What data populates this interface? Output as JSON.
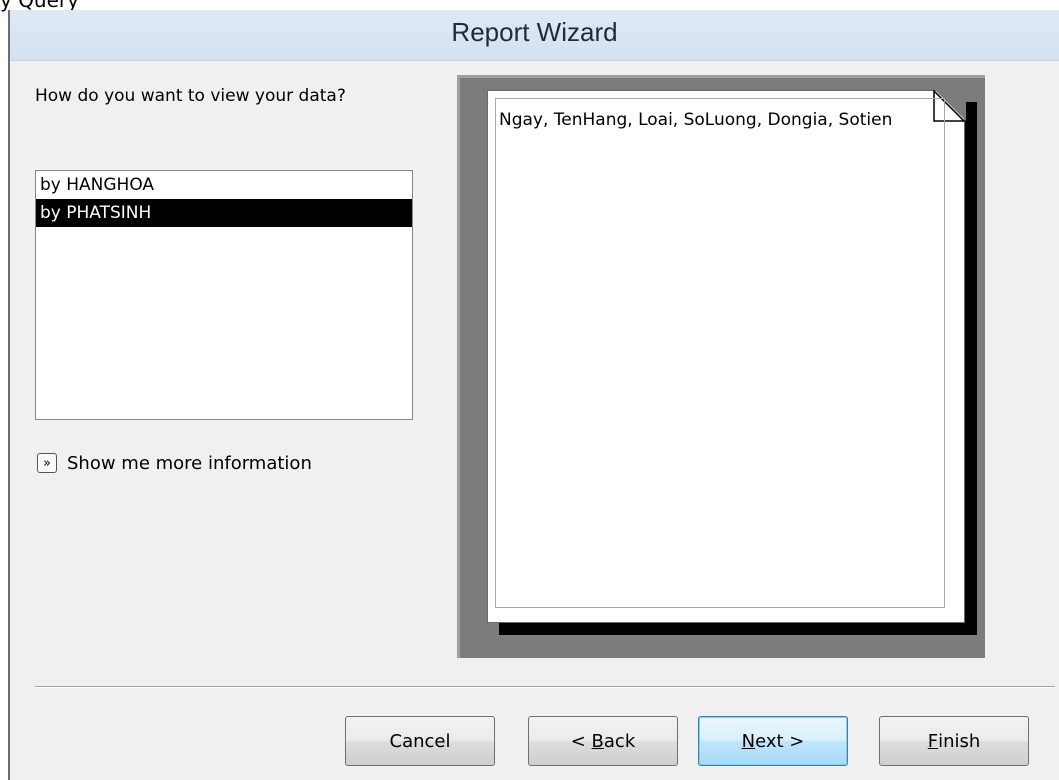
{
  "background": {
    "fragment_text": "y Query"
  },
  "window": {
    "title": "Report Wizard"
  },
  "prompt": {
    "question": "How do you want to view your data?"
  },
  "view_list": {
    "items": [
      {
        "label": "by HANGHOA",
        "selected": false
      },
      {
        "label": "by PHATSINH",
        "selected": true
      }
    ]
  },
  "more_info": {
    "label": "Show me more information",
    "icon": "double-chevron-right-icon"
  },
  "preview": {
    "fields_text": "Ngay, TenHang, Loai, SoLuong, Dongia, Sotien"
  },
  "buttons": {
    "cancel": {
      "label": "Cancel"
    },
    "back": {
      "label": "< Back",
      "prefix": "< ",
      "mnemonic": "B",
      "rest": "ack"
    },
    "next": {
      "label": "Next >",
      "mnemonic": "N",
      "rest": "ext >"
    },
    "finish": {
      "label": "Finish",
      "mnemonic": "F",
      "rest": "inish"
    }
  },
  "colors": {
    "titlebar": "#d3e1f1",
    "dialog_bg": "#f0f0f0",
    "selection_bg": "#000000",
    "default_button_border": "#3c7fb1"
  }
}
